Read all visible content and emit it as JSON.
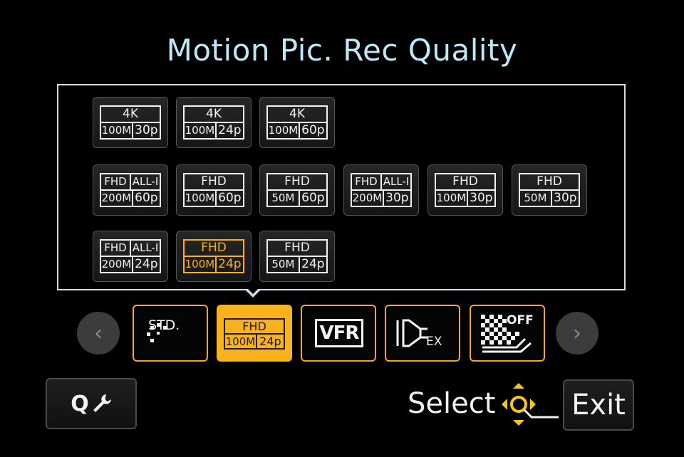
{
  "title": "Motion Pic. Rec Quality",
  "grid": {
    "rows": [
      [
        {
          "top": "4K",
          "rate": "100M",
          "fps": "30p"
        },
        {
          "top": "4K",
          "rate": "100M",
          "fps": "24p"
        },
        {
          "top": "4K",
          "rate": "100M",
          "fps": "60p"
        }
      ],
      [
        {
          "top": "FHD",
          "codec": "ALL-I",
          "rate": "200M",
          "fps": "60p"
        },
        {
          "top": "FHD",
          "rate": "100M",
          "fps": "60p"
        },
        {
          "top": "FHD",
          "rate": "50M",
          "fps": "60p"
        },
        {
          "top": "FHD",
          "codec": "ALL-I",
          "rate": "200M",
          "fps": "30p"
        },
        {
          "top": "FHD",
          "rate": "100M",
          "fps": "30p"
        },
        {
          "top": "FHD",
          "rate": "50M",
          "fps": "30p"
        }
      ],
      [
        {
          "top": "FHD",
          "codec": "ALL-I",
          "rate": "200M",
          "fps": "24p"
        },
        {
          "top": "FHD",
          "rate": "100M",
          "fps": "24p",
          "selected": true
        },
        {
          "top": "FHD",
          "rate": "50M",
          "fps": "24p"
        }
      ]
    ]
  },
  "tabs": {
    "standard": {
      "label": "STD.",
      "icon": "sparkle-icon"
    },
    "quality": {
      "top": "FHD",
      "rate": "100M",
      "fps": "24p",
      "active": true
    },
    "vfr": {
      "label": "VFR"
    },
    "ex_tele": {
      "label": "EX",
      "icon": "ex-tele-conversion-icon"
    },
    "off": {
      "label": "OFF",
      "icon": "grid-off-icon"
    }
  },
  "footer": {
    "quick_menu_label": "Q",
    "select_label": "Select",
    "exit_label": "Exit"
  },
  "colors": {
    "title": "#bfe8f6",
    "accent": "#f7b21c",
    "tile_border": "#f2f2f2"
  }
}
